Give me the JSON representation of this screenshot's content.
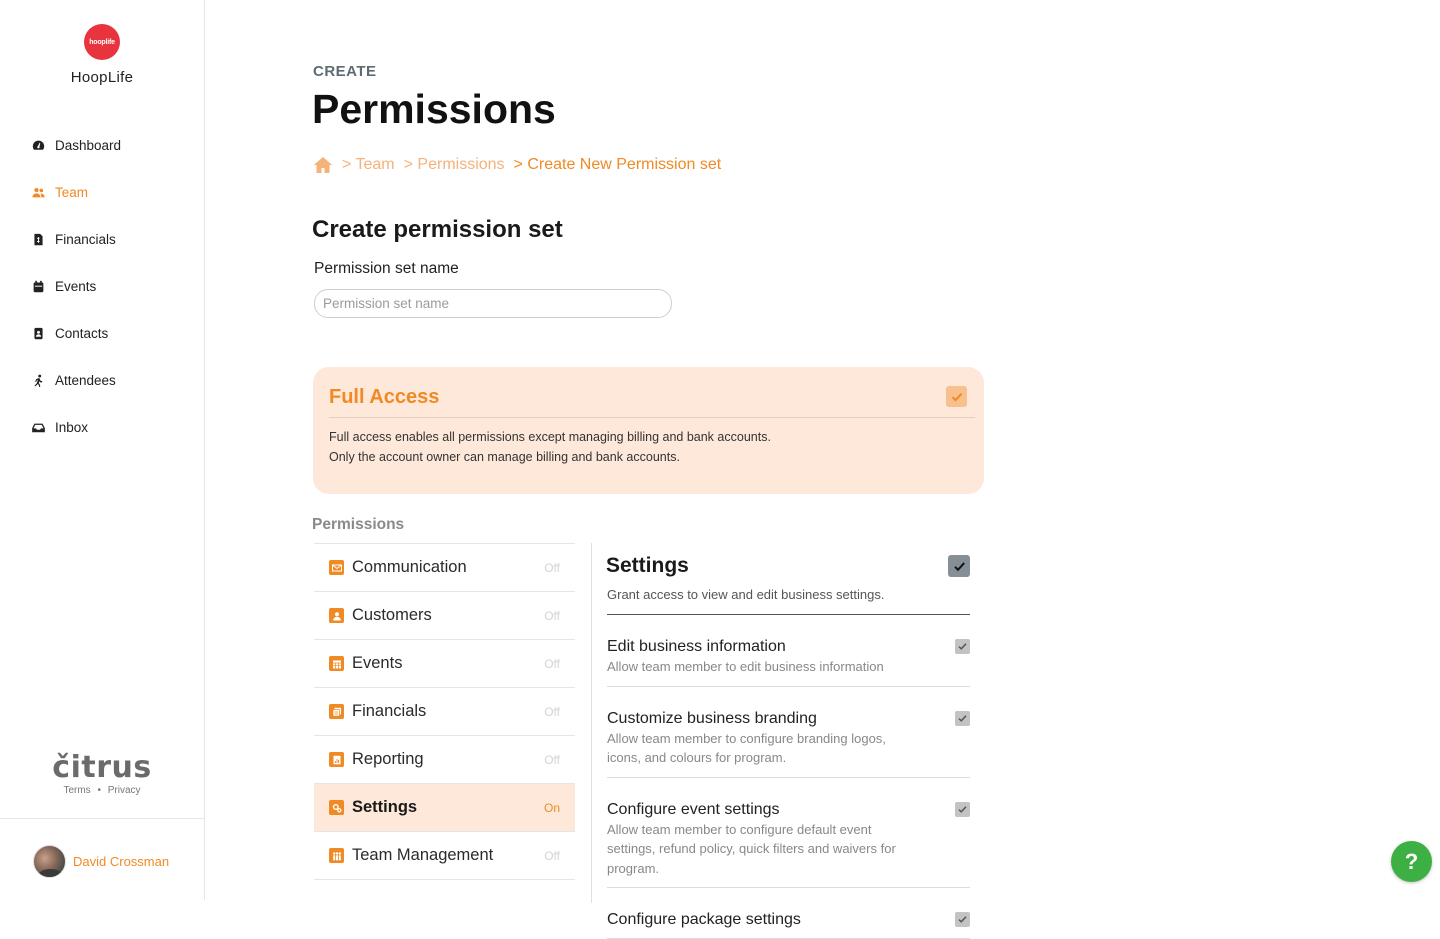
{
  "brand": {
    "logo_text": "hooplife",
    "name": "HoopLife",
    "logo_color": "#e8343f"
  },
  "nav": {
    "items": [
      {
        "label": "Dashboard",
        "icon": "dashboard-icon",
        "active": false
      },
      {
        "label": "Team",
        "icon": "users-icon",
        "active": true
      },
      {
        "label": "Financials",
        "icon": "invoice-icon",
        "active": false
      },
      {
        "label": "Events",
        "icon": "calendar-icon",
        "active": false
      },
      {
        "label": "Contacts",
        "icon": "contact-card-icon",
        "active": false
      },
      {
        "label": "Attendees",
        "icon": "running-person-icon",
        "active": false
      },
      {
        "label": "Inbox",
        "icon": "inbox-icon",
        "active": false
      }
    ]
  },
  "footer": {
    "powered_by": "čitrus",
    "terms": "Terms",
    "separator": "•",
    "privacy": "Privacy"
  },
  "user": {
    "name": "David Crossman"
  },
  "header": {
    "eyebrow": "CREATE",
    "title": "Permissions"
  },
  "breadcrumb": {
    "home_icon": "home-icon",
    "items": [
      "> Team",
      "> Permissions",
      "> Create New Permission set"
    ]
  },
  "form": {
    "section_title": "Create permission set",
    "name_label": "Permission set name",
    "name_placeholder": "Permission set name",
    "name_value": ""
  },
  "full_access": {
    "title": "Full Access",
    "checked": true,
    "desc_line1": "Full access enables all permissions except managing billing and bank accounts.",
    "desc_line2": "Only the account owner can manage billing and bank accounts."
  },
  "permissions": {
    "heading": "Permissions",
    "items": [
      {
        "label": "Communication",
        "status": "Off",
        "icon": "envelope-icon",
        "active": false
      },
      {
        "label": "Customers",
        "status": "Off",
        "icon": "person-icon",
        "active": false
      },
      {
        "label": "Events",
        "status": "Off",
        "icon": "calendar-icon",
        "active": false
      },
      {
        "label": "Financials",
        "status": "Off",
        "icon": "money-icon",
        "active": false
      },
      {
        "label": "Reporting",
        "status": "Off",
        "icon": "report-icon",
        "active": false
      },
      {
        "label": "Settings",
        "status": "On",
        "icon": "gears-icon",
        "active": true
      },
      {
        "label": "Team Management",
        "status": "Off",
        "icon": "team-icon",
        "active": false
      }
    ]
  },
  "detail": {
    "title": "Settings",
    "checked": true,
    "subtitle": "Grant access to view and edit business settings.",
    "sub_permissions": [
      {
        "title": "Edit business information",
        "desc": "Allow team member to edit business information",
        "checked": true
      },
      {
        "title": "Customize business branding",
        "desc": "Allow team member to configure branding logos, icons, and colours for program.",
        "checked": true
      },
      {
        "title": "Configure event settings",
        "desc": "Allow team member to configure default event settings, refund policy, quick filters and waivers for program.",
        "checked": true
      },
      {
        "title": "Configure package settings",
        "desc": "",
        "checked": true
      }
    ]
  },
  "help": {
    "label": "?",
    "color": "#3cb043"
  },
  "colors": {
    "accent": "#f08a24",
    "accent_light": "#fde8d9"
  }
}
